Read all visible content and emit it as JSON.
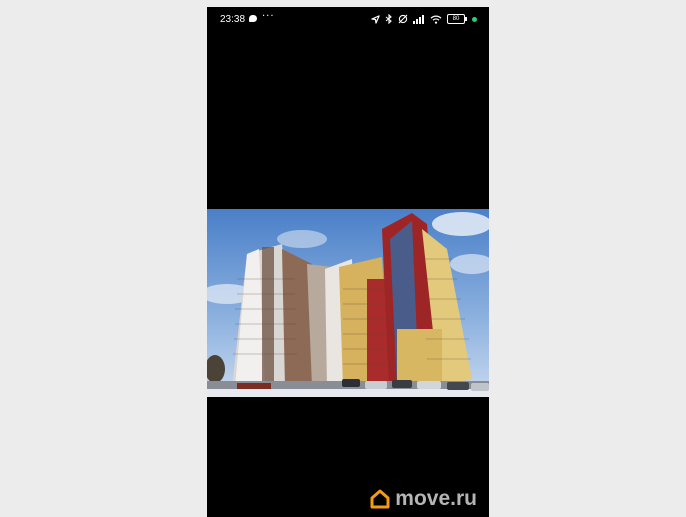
{
  "status_bar": {
    "time": "23:38",
    "more": "···",
    "battery": "80",
    "icons": [
      "chat-bubble-icon",
      "location-arrow-icon",
      "bluetooth-icon",
      "do-not-disturb-icon",
      "cell-signal-icon",
      "wifi-icon",
      "battery-icon",
      "dot-indicator-icon"
    ],
    "indicator_color": "#2ecc71"
  },
  "watermark": {
    "text": "move.ru",
    "logo": "house-logo",
    "logo_color": "#f39c12"
  }
}
